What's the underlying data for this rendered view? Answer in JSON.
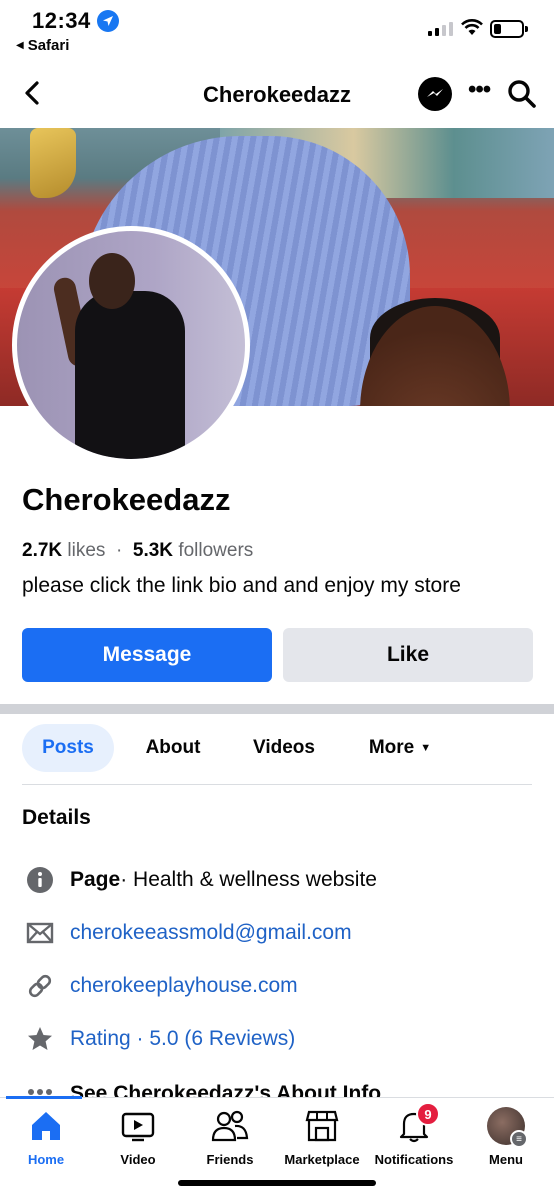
{
  "status_bar": {
    "time": "12:34",
    "back_app": "Safari"
  },
  "nav": {
    "title": "Cherokeedazz",
    "more": "•••"
  },
  "profile": {
    "name": "Cherokeedazz",
    "likes_count": "2.7K",
    "likes_label": "likes",
    "separator": "·",
    "followers_count": "5.3K",
    "followers_label": "followers",
    "bio": "please click the link bio and and enjoy my store"
  },
  "actions": {
    "message_label": "Message",
    "like_label": "Like"
  },
  "tabs": [
    {
      "label": "Posts",
      "active": true
    },
    {
      "label": "About"
    },
    {
      "label": "Videos"
    },
    {
      "label": "More"
    }
  ],
  "details": {
    "title": "Details",
    "page_label": "Page",
    "page_category": " · Health & wellness website",
    "email": "cherokeeassmold@gmail.com",
    "website": "cherokeeplayhouse.com",
    "rating": "Rating · 5.0 (6 Reviews)",
    "see_about": "See Cherokeedazz's About Info"
  },
  "tabbar": {
    "items": [
      {
        "label": "Home",
        "icon": "home-icon",
        "active": true
      },
      {
        "label": "Video",
        "icon": "video-icon"
      },
      {
        "label": "Friends",
        "icon": "friends-icon"
      },
      {
        "label": "Marketplace",
        "icon": "marketplace-icon"
      },
      {
        "label": "Notifications",
        "icon": "bell-icon",
        "badge": "9"
      },
      {
        "label": "Menu",
        "icon": "menu-avatar"
      }
    ]
  },
  "colors": {
    "accent": "#1b6ef3",
    "link": "#1f62c6",
    "badge": "#e41e3f"
  }
}
